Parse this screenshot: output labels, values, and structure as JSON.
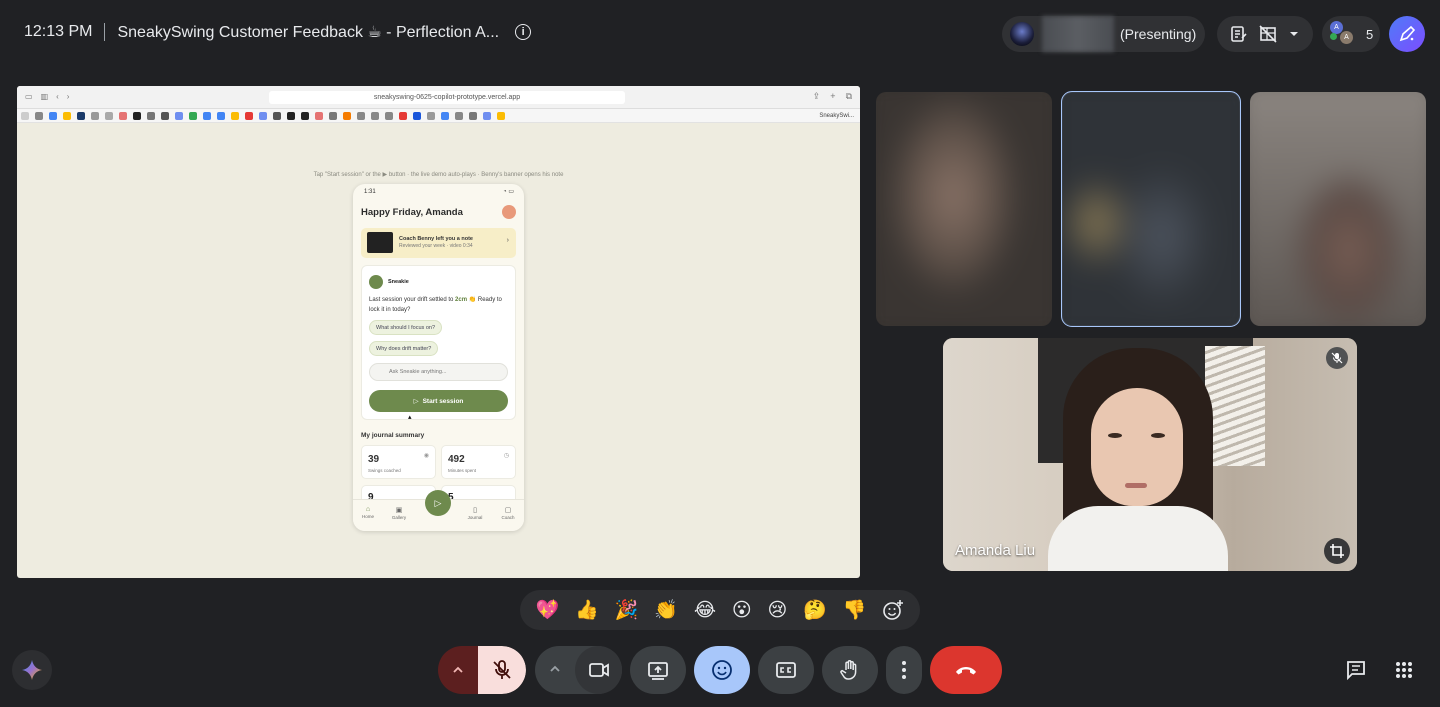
{
  "meeting": {
    "time": "12:13 PM",
    "title": "SneakySwing Customer Feedback ☕ - Perflection A...",
    "presenting_label": "(Presenting)",
    "participant_count": "5",
    "avatar_initials": [
      "A",
      "A"
    ]
  },
  "shared_screen": {
    "url": "sneakyswing-0625-copilot-prototype.vercel.app",
    "last_tab": "SneakySwi...",
    "hint": "Tap \"Start session\" or the ▶ button · the live demo auto-plays · Benny's banner opens his note",
    "phone": {
      "time": "1:31",
      "greeting": "Happy Friday, Amanda",
      "note": {
        "title": "Coach Benny left you a note",
        "subtitle": "Reviewed your week · video 0:34"
      },
      "assistant_name": "Sneakie",
      "message_prefix": "Last session your drift settled to ",
      "message_highlight": "2cm",
      "message_suffix": " 👏 Ready to lock it in today?",
      "chips": [
        "What should I focus on?",
        "Why does drift matter?"
      ],
      "ask_placeholder": "Ask Sneakie anything...",
      "start_button": "Start session",
      "journal_title": "My journal summary",
      "stats": [
        {
          "value": "39",
          "label": "Swings coached"
        },
        {
          "value": "492",
          "label": "Minutes spent"
        },
        {
          "value": "9",
          "label": ""
        },
        {
          "value": "5",
          "label": ""
        }
      ],
      "nav": [
        "Home",
        "Gallery",
        "Journal",
        "Coach"
      ]
    }
  },
  "participants": {
    "main_name": "Amanda Liu"
  },
  "reactions": [
    "💖",
    "👍",
    "🎉",
    "👏",
    "😂",
    "😮",
    "😢",
    "🤔",
    "👎"
  ],
  "colors": {
    "background": "#202124",
    "accent": "#a8c7fa",
    "end_call": "#dc362e",
    "mic_off": "#f9dedc",
    "brand_green": "#6e8a4d"
  }
}
